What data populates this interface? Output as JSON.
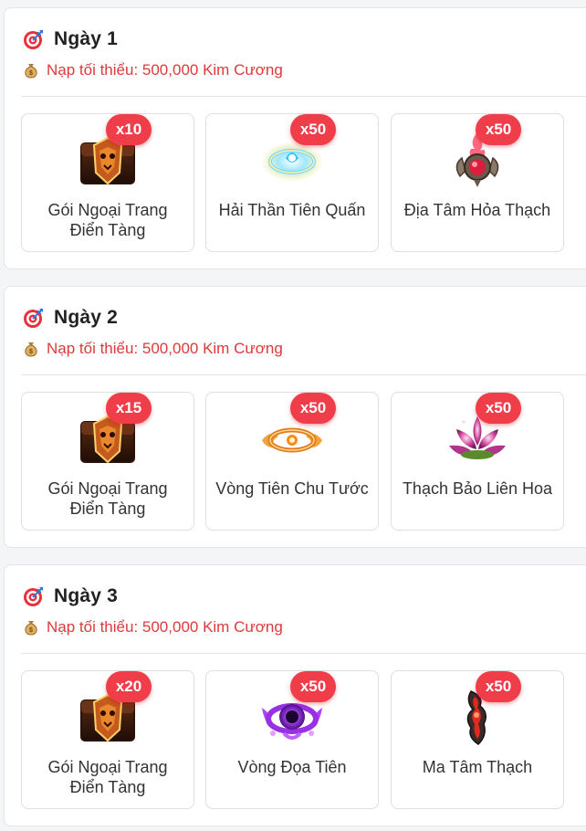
{
  "days": [
    {
      "title": "Ngày 1",
      "requirement": "Nạp tối thiểu: 500,000 Kim Cương",
      "items": [
        {
          "name": "Gói Ngoại Trang Điển Tàng",
          "qty": "x10",
          "icon": "chest-icon"
        },
        {
          "name": "Hải Thần Tiên Quấn",
          "qty": "x50",
          "icon": "sea-ring-icon"
        },
        {
          "name": "Địa Tâm Hỏa Thạch",
          "qty": "x50",
          "icon": "fire-stone-icon"
        }
      ]
    },
    {
      "title": "Ngày 2",
      "requirement": "Nạp tối thiểu: 500,000 Kim Cương",
      "items": [
        {
          "name": "Gói Ngoại Trang Điển Tàng",
          "qty": "x15",
          "icon": "chest-icon"
        },
        {
          "name": "Vòng Tiên Chu Tước",
          "qty": "x50",
          "icon": "phoenix-ring-icon"
        },
        {
          "name": "Thạch Bảo Liên Hoa",
          "qty": "x50",
          "icon": "lotus-gem-icon"
        }
      ]
    },
    {
      "title": "Ngày 3",
      "requirement": "Nạp tối thiểu: 500,000 Kim Cương",
      "items": [
        {
          "name": "Gói Ngoại Trang Điển Tàng",
          "qty": "x20",
          "icon": "chest-icon"
        },
        {
          "name": "Vòng Đọa Tiên",
          "qty": "x50",
          "icon": "dark-ring-icon"
        },
        {
          "name": "Ma Tâm Thạch",
          "qty": "x50",
          "icon": "demon-stone-icon"
        }
      ]
    }
  ],
  "colors": {
    "accent_red": "#dd3a3a",
    "badge_red": "#ef3e4a"
  }
}
